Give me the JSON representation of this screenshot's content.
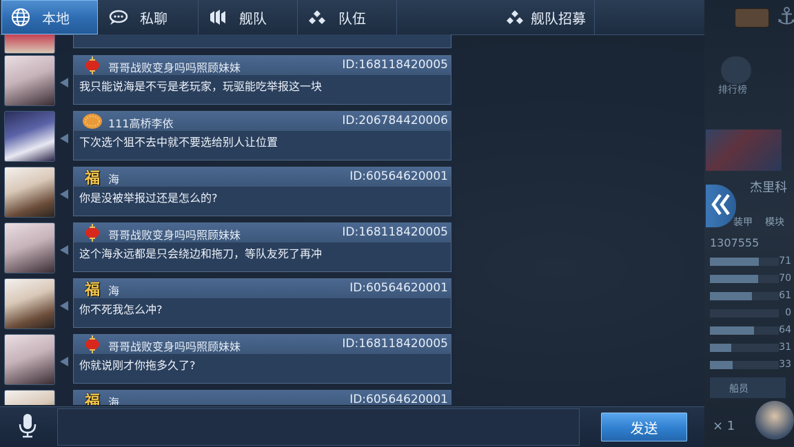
{
  "tabs": [
    {
      "label": "本地",
      "icon": "globe-icon",
      "active": true
    },
    {
      "label": "私聊",
      "icon": "chat-bubble-icon",
      "active": false
    },
    {
      "label": "舰队",
      "icon": "fleet-icon",
      "active": false
    },
    {
      "label": "队伍",
      "icon": "team-icon",
      "active": false
    },
    {
      "label": "舰队招募",
      "icon": "recruit-icon",
      "active": false
    }
  ],
  "messages": [
    {
      "name": "哥哥战败变身吗吗照顾妹妹",
      "uid": "ID:168118420005",
      "text": "我只能说海是不亏是老玩家，玩驱能吃举报这一块",
      "badge": "lantern-icon",
      "avatar": "anime-girls-avatar"
    },
    {
      "name": "111高桥李依",
      "uid": "ID:206784420006",
      "text": "下次选个狙不去中就不要选给别人让位置",
      "badge": "medal-icon",
      "avatar": "white-hair-avatar"
    },
    {
      "name": "海",
      "uid": "ID:60564620001",
      "text": "你是没被举报过还是怎么的?",
      "badge": "fu-icon",
      "avatar": "photo-avatar"
    },
    {
      "name": "哥哥战败变身吗吗照顾妹妹",
      "uid": "ID:168118420005",
      "text": "这个海永远都是只会绕边和拖刀，等队友死了再冲",
      "badge": "lantern-icon",
      "avatar": "anime-girls-avatar"
    },
    {
      "name": "海",
      "uid": "ID:60564620001",
      "text": "你不死我怎么冲?",
      "badge": "fu-icon",
      "avatar": "photo-avatar"
    },
    {
      "name": "哥哥战败变身吗吗照顾妹妹",
      "uid": "ID:168118420005",
      "text": "你就说刚才你拖多久了?",
      "badge": "lantern-icon",
      "avatar": "anime-girls-avatar"
    },
    {
      "name": "海",
      "uid": "ID:60564620001",
      "text": "",
      "badge": "fu-icon",
      "avatar": "photo-avatar"
    }
  ],
  "badge_glyph": "福",
  "input": {
    "value": "",
    "placeholder": ""
  },
  "send_label": "发送",
  "background": {
    "rank_label": "排行榜",
    "ship_name": "杰里科",
    "id_fragment": "1307555",
    "armor_label": "装甲",
    "module_label": "模块",
    "crew_label": "船员",
    "multiplier": "× 1",
    "stat_values": [
      "71",
      "70",
      "61",
      "0",
      "64",
      "31",
      "33"
    ],
    "stat_levels": [
      0.71,
      0.7,
      0.61,
      0.0,
      0.64,
      0.31,
      0.33
    ]
  },
  "colors": {
    "accent": "#2d6bb0",
    "panel": "#2a3f5c",
    "header": "#4b6891",
    "gold": "#f3c64a"
  }
}
